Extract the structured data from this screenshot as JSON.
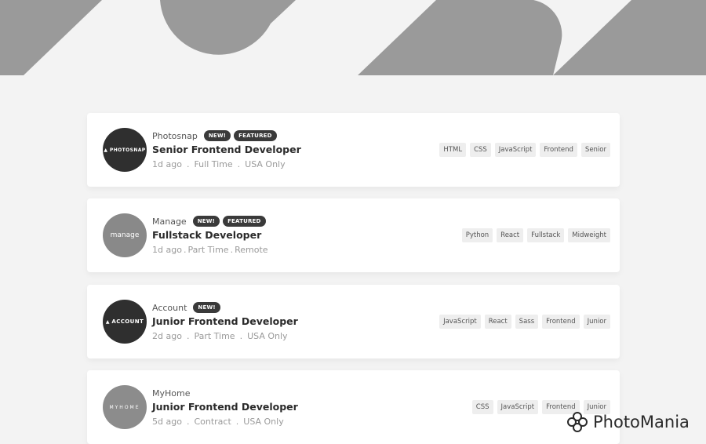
{
  "brand_watermark": "PhotoMania",
  "jobs": [
    {
      "company": "Photosnap",
      "logo_text": "PHOTOSNAP",
      "badges": [
        "NEW!",
        "FEATURED"
      ],
      "position": "Senior Frontend Developer",
      "posted": "1d ago",
      "contract": "Full Time",
      "location": "USA Only",
      "tags": [
        "HTML",
        "CSS",
        "JavaScript",
        "Frontend",
        "Senior"
      ]
    },
    {
      "company": "Manage",
      "logo_text": "manage",
      "badges": [
        "NEW!",
        "FEATURED"
      ],
      "position": "Fullstack Developer",
      "posted": "1d ago",
      "contract": "Part Time",
      "location": "Remote",
      "tags": [
        "Python",
        "React",
        "Fullstack",
        "Midweight"
      ]
    },
    {
      "company": "Account",
      "logo_text": "ACCOUNT",
      "badges": [
        "NEW!"
      ],
      "position": "Junior Frontend Developer",
      "posted": "2d ago",
      "contract": "Part Time",
      "location": "USA Only",
      "tags": [
        "JavaScript",
        "React",
        "Sass",
        "Frontend",
        "Junior"
      ]
    },
    {
      "company": "MyHome",
      "logo_text": "MYHOME",
      "badges": [],
      "position": "Junior Frontend Developer",
      "posted": "5d ago",
      "contract": "Contract",
      "location": "USA Only",
      "tags": [
        "CSS",
        "JavaScript",
        "Frontend",
        "Junior"
      ]
    }
  ]
}
